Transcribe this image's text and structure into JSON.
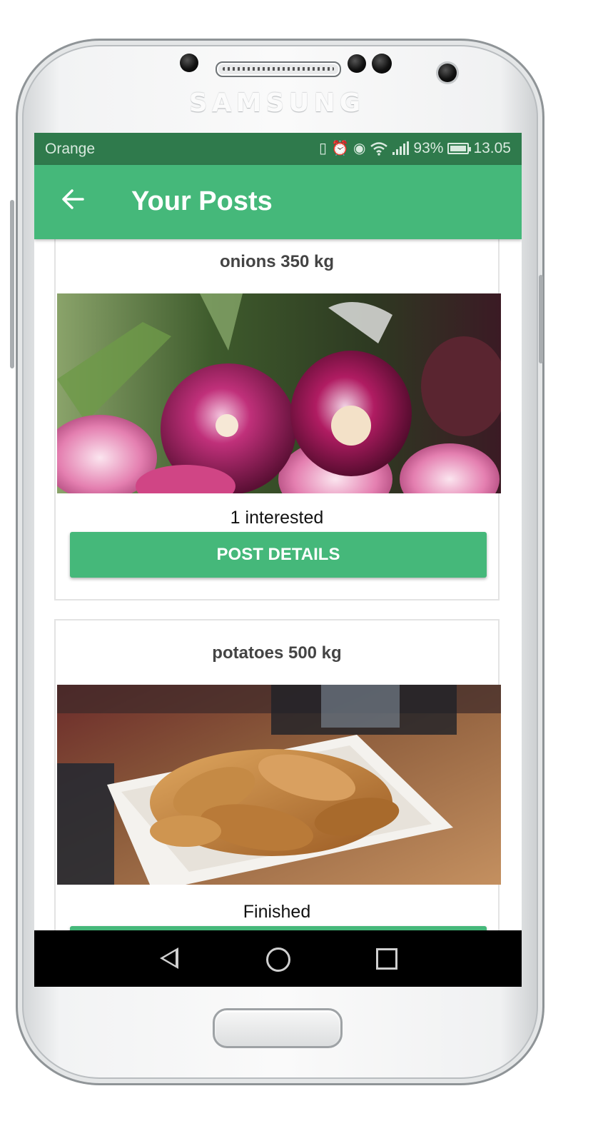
{
  "device": {
    "brand": "SAMSUNG"
  },
  "status_bar": {
    "carrier": "Orange",
    "battery": "93%",
    "time": "13.05",
    "icons": [
      "vibrate-icon",
      "alarm-icon",
      "eye-icon",
      "wifi-icon",
      "signal-icon",
      "battery-icon"
    ]
  },
  "app_bar": {
    "title": "Your Posts",
    "back_icon": "arrow-left-icon"
  },
  "posts": [
    {
      "title": "onions 350 kg",
      "status": "1 interested",
      "button": "POST DETAILS"
    },
    {
      "title": "potatoes 500 kg",
      "status": "Finished"
    }
  ],
  "colors": {
    "primary": "#45b87a",
    "status_bar": "#2f7a4c"
  },
  "nav_bar": {
    "icons": [
      "back-nav-icon",
      "home-nav-icon",
      "recents-nav-icon"
    ]
  }
}
